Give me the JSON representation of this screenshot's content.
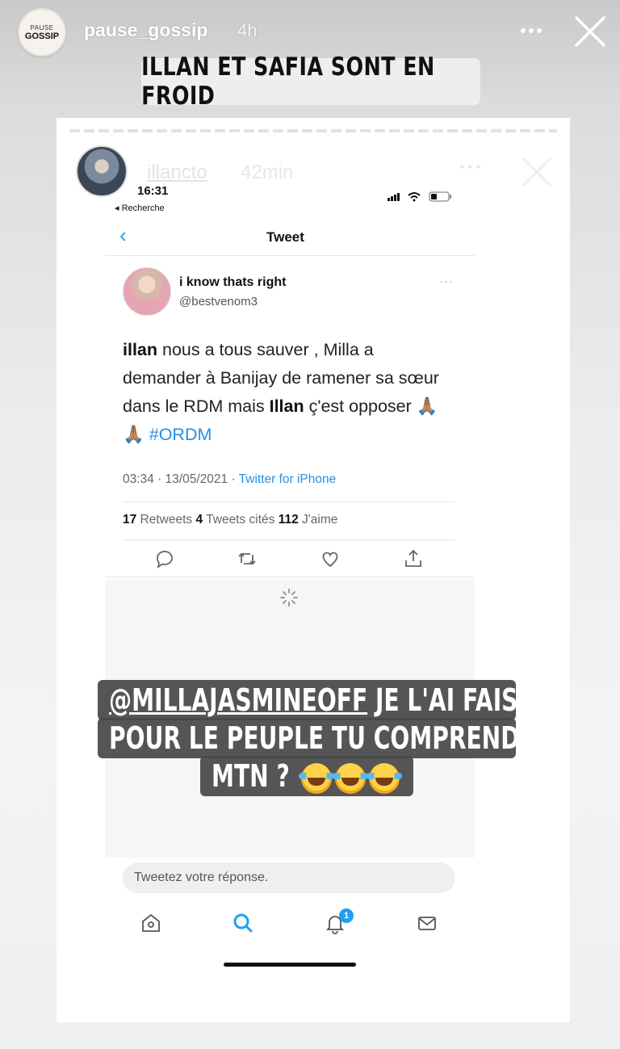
{
  "story": {
    "username": "pause_gossip",
    "time": "4h",
    "avatar_top": "PAUSE",
    "avatar_bottom": "GOSSIP",
    "headline": "ILLAN ET SAFIA SONT EN FROID"
  },
  "inner_story": {
    "username": "illancto",
    "time": "42min"
  },
  "phone": {
    "status_time": "16:31",
    "back_label": "◂ Recherche",
    "nav_back": "‹",
    "nav_title": "Tweet"
  },
  "tweet": {
    "display_name": "i know thats right",
    "handle": "@bestvenom3",
    "more": "···",
    "text_parts": {
      "p1_bold": "illan",
      "p1": " nous a tous sauver , Milla a demander à Banijay de ramener sa sœur dans le RDM mais ",
      "p2_bold": "Illan",
      "p2": " ç'est opposer 🙏🏽🙏🏽 ",
      "hashtag": "#ORDM"
    },
    "meta_time": "03:34 · 13/05/2021 · ",
    "meta_source": "Twitter for iPhone",
    "retweets_count": "17",
    "retweets_label": " Retweets  ",
    "quotes_count": "4",
    "quotes_label": " Tweets cités  ",
    "likes_count": "112",
    "likes_label": " J'aime",
    "reply_placeholder": "Tweetez votre réponse.",
    "notification_badge": "1"
  },
  "caption": {
    "line1_mention": "@MILLAJASMINEOFF",
    "line1_rest": " JE L'AI FAIS",
    "line2": "POUR LE PEUPLE TU COMPREND",
    "line3": "MTN ?"
  },
  "icons": {
    "outer_close": "close-icon",
    "inner_close": "close-icon",
    "reply": "reply-icon",
    "retweet": "retweet-icon",
    "like": "heart-icon",
    "share": "share-icon",
    "home": "home-icon",
    "search": "search-icon",
    "notifications": "bell-icon",
    "messages": "mail-icon"
  },
  "colors": {
    "twitter_blue": "#1da1f2",
    "caption_bg": "#484848"
  }
}
